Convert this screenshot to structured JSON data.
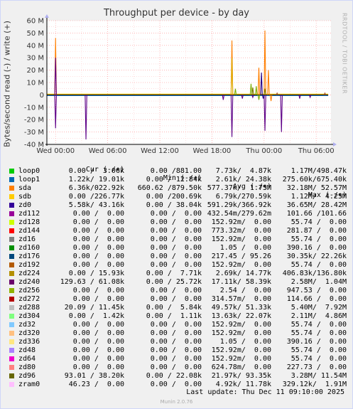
{
  "chart_data": {
    "type": "line",
    "title": "Throughput per device - by day",
    "ylabel": "Bytes/second read (-) / write (+)",
    "ylim": [
      -40000000,
      60000000
    ],
    "yticks": [
      "60 M",
      "50 M",
      "40 M",
      "30 M",
      "20 M",
      "10 M",
      "0",
      "-10 M",
      "-20 M",
      "-30 M",
      "-40 M"
    ],
    "ytick_values": [
      60000000,
      50000000,
      40000000,
      30000000,
      20000000,
      10000000,
      0,
      -10000000,
      -20000000,
      -30000000,
      -40000000
    ],
    "xlim_hours": [
      -1,
      31.7
    ],
    "xticks": [
      "Wed 00:00",
      "Wed 06:00",
      "Wed 12:00",
      "Wed 18:00",
      "Thu 00:00",
      "Thu 06:00"
    ],
    "xtick_hours": [
      0,
      6,
      12,
      18,
      24,
      30
    ],
    "grid": true,
    "series": [
      {
        "name": "sda",
        "color": "#FF7F00",
        "spikes": [
          [
            0,
            46000000
          ],
          [
            20.3,
            44000000
          ],
          [
            23.4,
            22000000
          ],
          [
            24.1,
            52000000
          ],
          [
            24.5,
            20000000
          ],
          [
            24.8,
            -5000000
          ]
        ]
      },
      {
        "name": "zd240",
        "color": "#5E0087",
        "spikes": [
          [
            0,
            -27000000
          ],
          [
            0,
            30000000
          ],
          [
            3.5,
            -36000000
          ],
          [
            19.3,
            -4000000
          ],
          [
            20.3,
            -34000000
          ],
          [
            21.5,
            -3000000
          ],
          [
            22.7,
            -2000000
          ],
          [
            24.1,
            -29000000
          ],
          [
            26,
            -30000000
          ],
          [
            28.1,
            -3000000
          ],
          [
            29.3,
            -2000000
          ]
        ]
      },
      {
        "name": "zd304",
        "color": "#7BAD00",
        "spikes": [
          [
            20.7,
            5000000
          ],
          [
            22.5,
            9000000
          ],
          [
            23.1,
            7000000
          ],
          [
            23.4,
            -4000000
          ]
        ]
      },
      {
        "name": "zd96",
        "color": "#7A7A00",
        "spikes": [
          [
            22.7,
            6000000
          ],
          [
            24.1,
            5000000
          ]
        ]
      },
      {
        "name": "zd0",
        "color": "#220088",
        "spikes": [
          [
            23.7,
            18000000
          ],
          [
            23.9,
            -3000000
          ]
        ]
      },
      {
        "name": "zd320",
        "color": "#DDAA00",
        "spikes": [
          [
            20.3,
            30000000
          ]
        ]
      },
      {
        "name": "zd192",
        "color": "#A8532C",
        "spikes": [
          [
            25.5,
            1500000
          ],
          [
            31,
            1500000
          ]
        ]
      }
    ]
  },
  "legend": {
    "headers": {
      "cur": "Cur (-/+)",
      "min": "Min (-/+)",
      "avg": "Avg (-/+)",
      "max": "Max (-/+)"
    },
    "rows": [
      {
        "name": "loop0",
        "color": "#00CC00",
        "cur": "0.00 /  3.06k",
        "min": "0.00 /881.00",
        "avg": "7.73k/  4.87k",
        "max": "1.17M/498.47k"
      },
      {
        "name": "loop1",
        "color": "#0066B3",
        "cur": "1.22k/ 19.01k",
        "min": "0.00 / 12.84k",
        "avg": "2.61k/ 24.38k",
        "max": "275.60k/675.40k"
      },
      {
        "name": "sda",
        "color": "#FF7F00",
        "cur": "6.36k/022.92k",
        "min": "660.62 /879.50k",
        "avg": "577.37k/  1.75M",
        "max": "32.18M/ 52.57M"
      },
      {
        "name": "sdb",
        "color": "#FFCC00",
        "cur": "0.00 /226.77k",
        "min": "0.00 /200.69k",
        "avg": "6.79k/270.59k",
        "max": "1.12M/  4.25M"
      },
      {
        "name": "zd0",
        "color": "#330099",
        "cur": "5.58k/ 43.16k",
        "min": "0.00 / 38.04k",
        "avg": "591.29k/366.92k",
        "max": "36.65M/ 28.42M"
      },
      {
        "name": "zd112",
        "color": "#990099",
        "cur": "0.00 /  0.00",
        "min": "0.00 /  0.00",
        "avg": "432.54m/279.62m",
        "max": "101.66 /101.66"
      },
      {
        "name": "zd128",
        "color": "#CCFF00",
        "cur": "0.00 /  0.00",
        "min": "0.00 /  0.00",
        "avg": "152.92m/  0.00",
        "max": "55.74 /  0.00"
      },
      {
        "name": "zd144",
        "color": "#FF0000",
        "cur": "0.00 /  0.00",
        "min": "0.00 /  0.00",
        "avg": "773.32m/  0.00",
        "max": "281.87 /  0.00"
      },
      {
        "name": "zd16",
        "color": "#808080",
        "cur": "0.00 /  0.00",
        "min": "0.00 /  0.00",
        "avg": "152.92m/  0.00",
        "max": "55.74 /  0.00"
      },
      {
        "name": "zd160",
        "color": "#008F00",
        "cur": "0.00 /  0.00",
        "min": "0.00 /  0.00",
        "avg": "1.05 /  0.00",
        "max": "390.16 /  0.00"
      },
      {
        "name": "zd176",
        "color": "#00487D",
        "cur": "0.00 /  0.00",
        "min": "0.00 /  0.00",
        "avg": "217.45 / 95.26",
        "max": "30.35k/ 22.26k"
      },
      {
        "name": "zd192",
        "color": "#B35A00",
        "cur": "0.00 /  0.00",
        "min": "0.00 /  0.00",
        "avg": "152.92m/  0.00",
        "max": "55.74 /  0.00"
      },
      {
        "name": "zd224",
        "color": "#B38F00",
        "cur": "0.00 / 15.93k",
        "min": "0.00 /  7.71k",
        "avg": "2.69k/ 14.77k",
        "max": "406.83k/136.80k"
      },
      {
        "name": "zd240",
        "color": "#6B006B",
        "cur": "129.63 / 61.08k",
        "min": "0.00 / 25.72k",
        "avg": "17.11k/ 58.39k",
        "max": "2.58M/  1.04M"
      },
      {
        "name": "zd256",
        "color": "#8FB300",
        "cur": "0.00 /  0.00",
        "min": "0.00 /  0.00",
        "avg": "2.54 /  0.00",
        "max": "947.53 /  0.00"
      },
      {
        "name": "zd272",
        "color": "#B30000",
        "cur": "0.00 /  0.00",
        "min": "0.00 /  0.00",
        "avg": "314.57m/  0.00",
        "max": "114.66 /  0.00"
      },
      {
        "name": "zd288",
        "color": "#BEBEBE",
        "cur": "20.09 / 11.45k",
        "min": "0.00 /  5.84k",
        "avg": "49.57k/ 51.33k",
        "max": "5.40M/  7.92M"
      },
      {
        "name": "zd304",
        "color": "#80FF80",
        "cur": "0.00 /  1.42k",
        "min": "0.00 /  1.11k",
        "avg": "13.63k/ 22.07k",
        "max": "2.11M/  4.86M"
      },
      {
        "name": "zd32",
        "color": "#80C9FF",
        "cur": "0.00 /  0.00",
        "min": "0.00 /  0.00",
        "avg": "152.92m/  0.00",
        "max": "55.74 /  0.00"
      },
      {
        "name": "zd320",
        "color": "#FFC080",
        "cur": "0.00 /  0.00",
        "min": "0.00 /  0.00",
        "avg": "152.92m/  0.00",
        "max": "55.74 /  0.00"
      },
      {
        "name": "zd336",
        "color": "#FFE680",
        "cur": "0.00 /  0.00",
        "min": "0.00 /  0.00",
        "avg": "1.05 /  0.00",
        "max": "390.16 /  0.00"
      },
      {
        "name": "zd48",
        "color": "#AA80FF",
        "cur": "0.00 /  0.00",
        "min": "0.00 /  0.00",
        "avg": "152.92m/  0.00",
        "max": "55.74 /  0.00"
      },
      {
        "name": "zd64",
        "color": "#EE00CC",
        "cur": "0.00 /  0.00",
        "min": "0.00 /  0.00",
        "avg": "152.92m/  0.00",
        "max": "55.74 /  0.00"
      },
      {
        "name": "zd80",
        "color": "#FF8080",
        "cur": "0.00 /  0.00",
        "min": "0.00 /  0.00",
        "avg": "624.78m/  0.00",
        "max": "227.73 /  0.00"
      },
      {
        "name": "zd96",
        "color": "#666600",
        "cur": "93.01 / 38.20k",
        "min": "0.00 / 22.08k",
        "avg": "21.97k/ 93.35k",
        "max": "3.28M/ 11.54M"
      },
      {
        "name": "zram0",
        "color": "#FFBFFF",
        "cur": "46.23 /  0.00",
        "min": "0.00 /  0.00",
        "avg": "4.92k/ 11.78k",
        "max": "329.12k/  1.91M"
      }
    ]
  },
  "last_update": "Last update: Thu Dec 11 09:10:00 2025",
  "version": "Munin 2.0.76",
  "watermark": "RRDTOOL / TOBI OETIKER"
}
